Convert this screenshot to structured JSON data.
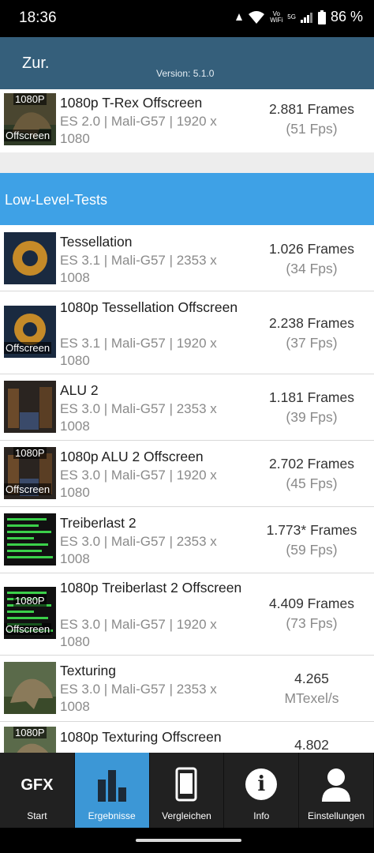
{
  "status_bar": {
    "time": "18:36",
    "volte_top": "Vo",
    "volte_bottom": "WiFi",
    "signal_label": "5G",
    "battery": "86 %"
  },
  "header": {
    "back_label": "Zur.",
    "version": "Version: 5.1.0"
  },
  "rows_top": [
    {
      "tag": "1080P",
      "tag2": "Offscreen",
      "name": "1080p T-Rex Offscreen",
      "sub": "ES 2.0 | Mali-G57 | 1920 x 1080",
      "value": "2.881 Frames",
      "fps": "(51 Fps)"
    }
  ],
  "section_title": "Low-Level-Tests",
  "tests": [
    {
      "name": "Tessellation",
      "sub": "ES 3.1 | Mali-G57 | 2353 x 1008",
      "value": "1.026 Frames",
      "fps": "(34 Fps)",
      "tag": "",
      "tag2": ""
    },
    {
      "name": "1080p Tessellation Offscreen",
      "sub": "ES 3.1 | Mali-G57 | 1920 x 1080",
      "value": "2.238 Frames",
      "fps": "(37 Fps)",
      "tag": "",
      "tag2": "Offscreen"
    },
    {
      "name": "ALU 2",
      "sub": "ES 3.0 | Mali-G57 | 2353 x 1008",
      "value": "1.181 Frames",
      "fps": "(39 Fps)",
      "tag": "",
      "tag2": ""
    },
    {
      "name": "1080p ALU 2 Offscreen",
      "sub": "ES 3.0 | Mali-G57 | 1920 x 1080",
      "value": "2.702 Frames",
      "fps": "(45 Fps)",
      "tag": "1080P",
      "tag2": "Offscreen"
    },
    {
      "name": "Treiberlast 2",
      "sub": "ES 3.0 | Mali-G57 | 2353 x 1008",
      "value": "1.773* Frames",
      "fps": "(59 Fps)",
      "tag": "",
      "tag2": ""
    },
    {
      "name": "1080p Treiberlast 2 Offscreen",
      "sub": "ES 3.0 | Mali-G57 | 1920 x 1080",
      "value": "4.409 Frames",
      "fps": "(73 Fps)",
      "tag": "1080P",
      "tag2": "Offscreen"
    },
    {
      "name": "Texturing",
      "sub": "ES 3.0 | Mali-G57 | 2353 x 1008",
      "value": "4.265",
      "fps": "MTexel/s",
      "tag": "",
      "tag2": ""
    },
    {
      "name": "1080p Texturing Offscreen",
      "sub": "",
      "value": "4.802",
      "fps": "",
      "tag": "1080P",
      "tag2": ""
    }
  ],
  "nav": [
    {
      "label": "Start",
      "icon": "gfx-logo-icon",
      "icon_text": "GFX"
    },
    {
      "label": "Ergebnisse",
      "icon": "bar-chart-icon"
    },
    {
      "label": "Vergleichen",
      "icon": "phone-icon"
    },
    {
      "label": "Info",
      "icon": "info-icon",
      "icon_text": "i"
    },
    {
      "label": "Einstellungen",
      "icon": "user-icon"
    }
  ]
}
